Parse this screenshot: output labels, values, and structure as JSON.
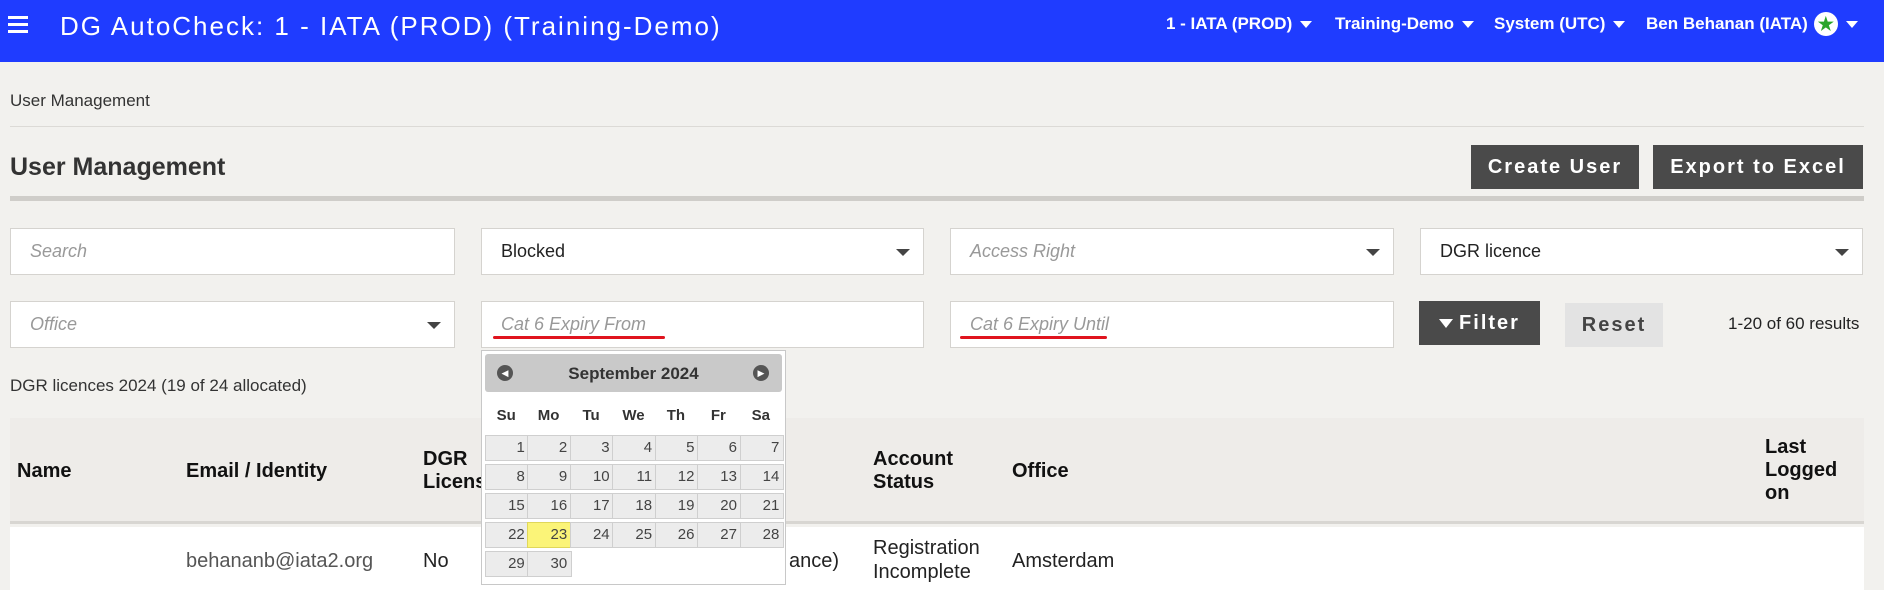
{
  "topbar": {
    "title": "DG AutoCheck: 1 - IATA (PROD) (Training-Demo)",
    "menus": [
      "1 - IATA (PROD)",
      "Training-Demo",
      "System (UTC)",
      "Ben Behanan (IATA)"
    ],
    "brand_color": "#1f3cff"
  },
  "breadcrumb": "User Management",
  "page_title": "User Management",
  "actions": {
    "create_user": "Create User",
    "export_excel": "Export to Excel"
  },
  "filters": {
    "search_placeholder": "Search",
    "status_value": "Blocked",
    "access_right_placeholder": "Access Right",
    "licence_value": "DGR licence",
    "office_placeholder": "Office",
    "cat6_from_placeholder": "Cat 6 Expiry From",
    "cat6_until_placeholder": "Cat 6 Expiry Until",
    "filter_label": "Filter",
    "reset_label": "Reset"
  },
  "results_text": "1-20 of 60 results",
  "licences_text": "DGR licences 2024 (19 of 24 allocated)",
  "table": {
    "headers": {
      "name": "Name",
      "email": "Email / Identity",
      "dgr": "DGR\nLicens",
      "account_status": "Account\nStatus",
      "office": "Office",
      "last_logged": "Last\nLogged\non"
    },
    "rows": [
      {
        "email": "behananb@iata2.org",
        "dgr": "No",
        "partial": "ance)",
        "account_status": "Registration\nIncomplete",
        "office": "Amsterdam"
      }
    ]
  },
  "datepicker": {
    "month_year": "September 2024",
    "weekdays": [
      "Su",
      "Mo",
      "Tu",
      "We",
      "Th",
      "Fr",
      "Sa"
    ],
    "weeks": [
      [
        "1",
        "2",
        "3",
        "4",
        "5",
        "6",
        "7"
      ],
      [
        "8",
        "9",
        "10",
        "11",
        "12",
        "13",
        "14"
      ],
      [
        "15",
        "16",
        "17",
        "18",
        "19",
        "20",
        "21"
      ],
      [
        "22",
        "23",
        "24",
        "25",
        "26",
        "27",
        "28"
      ],
      [
        "29",
        "30"
      ]
    ],
    "today": "23",
    "prev_icon": "chevron-left-icon",
    "next_icon": "chevron-right-icon"
  }
}
